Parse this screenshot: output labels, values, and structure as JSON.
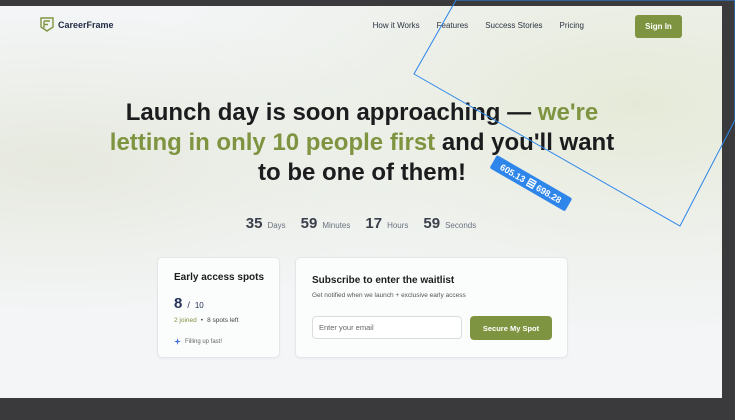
{
  "brand": {
    "name": "CareerFrame",
    "accent": "#7f9440"
  },
  "nav": {
    "links": [
      "How it Works",
      "Features",
      "Success Stories",
      "Pricing"
    ],
    "signin": "Sign In"
  },
  "headline": {
    "part1": "Launch day is soon approaching — ",
    "part2_accent": "we're letting in only 10 people first",
    "part3": " and you'll want to be one of them!"
  },
  "countdown": [
    {
      "value": "35",
      "label": "Days"
    },
    {
      "value": "59",
      "label": "Minutes"
    },
    {
      "value": "17",
      "label": "Hours"
    },
    {
      "value": "59",
      "label": "Seconds"
    }
  ],
  "spots": {
    "title": "Early access spots",
    "current": "8",
    "slash": "/",
    "total": "10",
    "joined": "2 joined",
    "bullet": "•",
    "left": "8 spots left",
    "filling": "Filling up fast!"
  },
  "waitlist": {
    "title": "Subscribe to enter the waitlist",
    "subtitle": "Get notified when we launch + exclusive early access",
    "email_placeholder": "Enter your email",
    "button": "Secure My Spot"
  },
  "overlay": {
    "measure_a": "605.13",
    "measure_b": "698.28",
    "icon": "ruler-icon"
  }
}
